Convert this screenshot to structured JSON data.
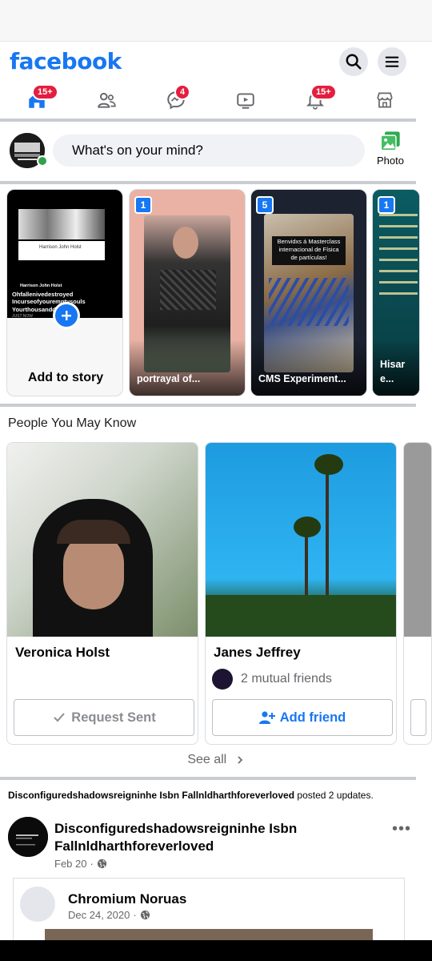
{
  "app": {
    "logo": "facebook",
    "brand_color": "#1877f2"
  },
  "tabs": [
    {
      "name": "home",
      "badge": "15+"
    },
    {
      "name": "friends",
      "badge": ""
    },
    {
      "name": "messages",
      "badge": "4"
    },
    {
      "name": "watch",
      "badge": ""
    },
    {
      "name": "notifications",
      "badge": "15+"
    },
    {
      "name": "marketplace",
      "badge": ""
    }
  ],
  "composer": {
    "placeholder": "What's on your mind?",
    "photo_label": "Photo"
  },
  "stories": [
    {
      "caption": "Add to story",
      "count": ""
    },
    {
      "caption": "portrayal of...",
      "count": "1"
    },
    {
      "caption": "CMS Experiment...",
      "count": "5"
    },
    {
      "caption": "Hisar e...",
      "count": "1"
    }
  ],
  "story_inner": {
    "s1_name": "Harrison John Holst",
    "s1_lines": [
      "Harrison John Holst",
      "Ohfallenivedestroyed",
      "Incurseofyouremptysouls",
      "Yourthousanddre..."
    ],
    "s1_time": "JUST NOW",
    "s3_text": "Benvidxs á Masterclass internacional de Física de partículas!"
  },
  "pymk": {
    "title": "People You May Know",
    "people": [
      {
        "name": "Veronica Holst",
        "mutual": "",
        "button": "Request Sent"
      },
      {
        "name": "Janes Jeffrey",
        "mutual": "2 mutual friends",
        "button": "Add friend"
      }
    ],
    "see_all": "See all"
  },
  "feed": {
    "posted_by": "Disconfiguredshadowsreigninhe Isbn Fallnldharthforeverloved",
    "posted_suffix": "posted 2 updates.",
    "post_author": "Disconfiguredshadowsreigninhe Isbn Fallnldharthforeverloved",
    "post_date": "Feb 20",
    "shared_author": "Chromium Noruas",
    "shared_date": "Dec 24, 2020"
  }
}
